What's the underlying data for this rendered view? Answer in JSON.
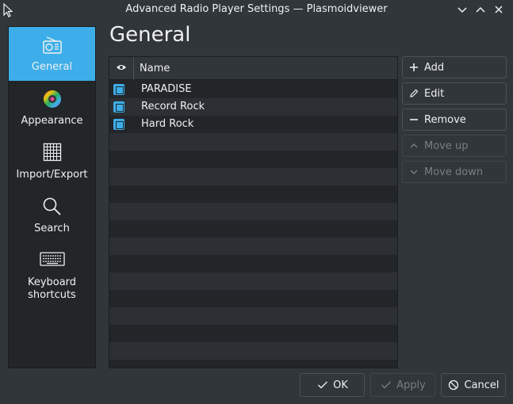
{
  "window": {
    "title": "Advanced Radio Player Settings — Plasmoidviewer"
  },
  "sidebar": {
    "items": [
      {
        "label": "General",
        "icon": "radio-icon"
      },
      {
        "label": "Appearance",
        "icon": "color-wheel-icon"
      },
      {
        "label": "Import/Export",
        "icon": "grid-icon"
      },
      {
        "label": "Search",
        "icon": "search-icon"
      },
      {
        "label": "Keyboard shortcuts",
        "line1": "Keyboard",
        "line2": "shortcuts",
        "icon": "keyboard-icon"
      }
    ]
  },
  "page": {
    "title": "General"
  },
  "list": {
    "header_name": "Name",
    "rows": [
      {
        "name": "PARADISE",
        "checked": true
      },
      {
        "name": "Record Rock",
        "checked": true
      },
      {
        "name": "Hard Rock",
        "checked": true
      }
    ]
  },
  "side_buttons": {
    "add": "Add",
    "edit": "Edit",
    "remove": "Remove",
    "move_up": "Move up",
    "move_down": "Move down"
  },
  "footer": {
    "ok": "OK",
    "apply": "Apply",
    "cancel": "Cancel"
  },
  "colors": {
    "accent": "#3daee9",
    "background": "#31363b",
    "view_background": "#232629"
  }
}
